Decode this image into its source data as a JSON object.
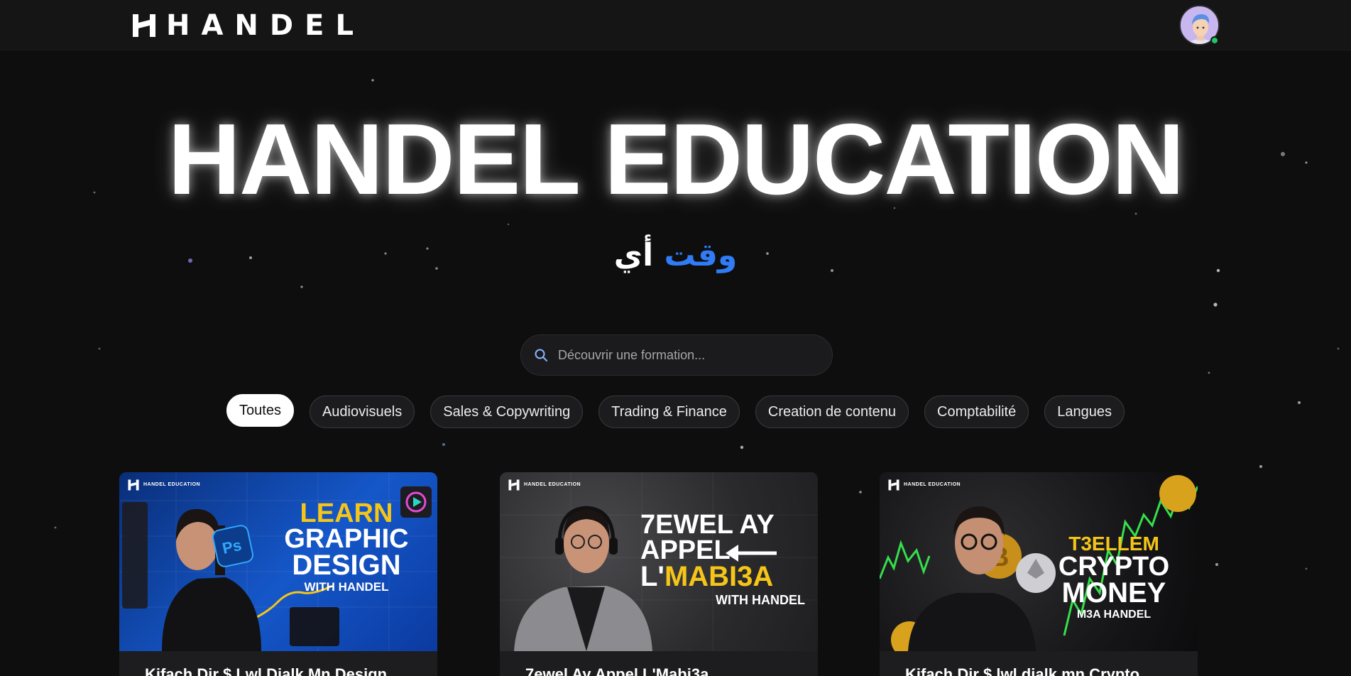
{
  "header": {
    "logo_text": "HANDEL",
    "logo_icon": "handel-logo-mark",
    "avatar_icon": "user-avatar",
    "online_status": "online"
  },
  "hero": {
    "title": "HANDEL EDUCATION",
    "subtitle_word_1": "أي",
    "subtitle_word_2": "وقت"
  },
  "search": {
    "placeholder": "Découvrir une formation...",
    "value": "",
    "icon": "search-icon"
  },
  "filters": [
    {
      "label": "Toutes",
      "active": true
    },
    {
      "label": "Audiovisuels",
      "active": false
    },
    {
      "label": "Sales & Copywriting",
      "active": false
    },
    {
      "label": "Trading & Finance",
      "active": false
    },
    {
      "label": "Creation de contenu",
      "active": false
    },
    {
      "label": "Comptabilité",
      "active": false
    },
    {
      "label": "Langues",
      "active": false
    }
  ],
  "courses": [
    {
      "title": "Kifach Dir $ Lwl Djalk Mn Design",
      "thumb_brand": "HANDEL EDUCATION",
      "thumb_line_1": "LEARN",
      "thumb_line_2": "GRAPHIC",
      "thumb_line_3": "DESIGN",
      "thumb_line_4": "WITH HANDEL",
      "thumb_badge": "Ps",
      "colors": {
        "bg": "#0d3a8c",
        "accent": "#f5c518"
      }
    },
    {
      "title": "7ewel Ay Appel L'Mabi3a",
      "thumb_brand": "HANDEL EDUCATION",
      "thumb_line_1": "7EWEL AY",
      "thumb_line_2": "APPEL",
      "thumb_line_3_a": "L'",
      "thumb_line_3_b": "MABI3A",
      "thumb_line_4": "WITH HANDEL",
      "colors": {
        "bg": "#2a2a2c",
        "accent": "#f5c518"
      }
    },
    {
      "title": "Kifach Dir $ lwl djalk mn Crypto",
      "thumb_brand": "HANDEL EDUCATION",
      "thumb_line_1": "T3ELLEM",
      "thumb_line_2": "CRYPTO",
      "thumb_line_3": "MONEY",
      "thumb_line_4": "M3A HANDEL",
      "colors": {
        "bg": "#0f1a12",
        "accent": "#f5c518"
      }
    }
  ],
  "colors": {
    "background": "#0e0e0f",
    "topbar": "#151516",
    "accent_blue": "#2f7cf6",
    "chip_bg": "#1c1c1e"
  }
}
